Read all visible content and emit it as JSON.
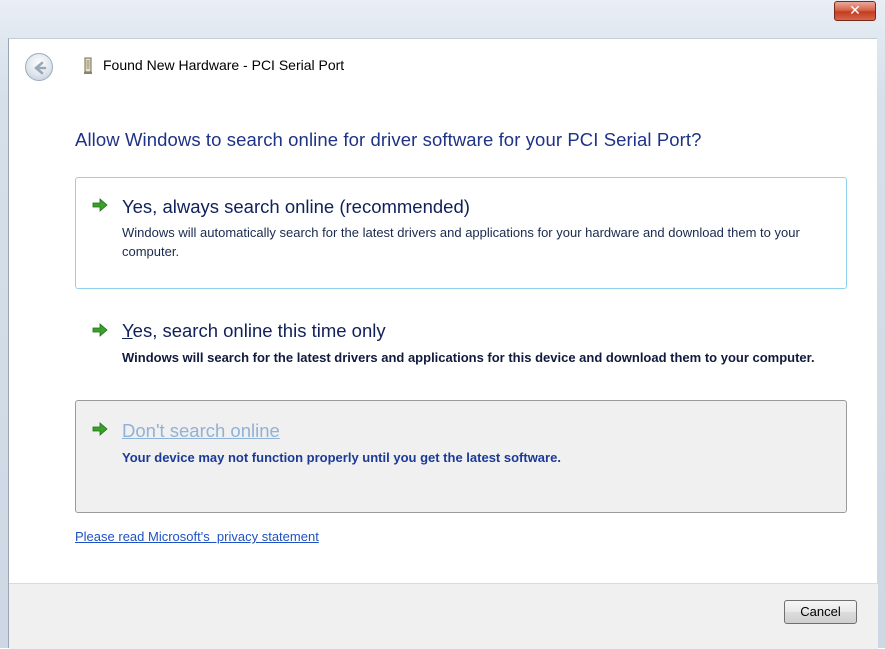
{
  "window": {
    "title": "Found New Hardware - PCI Serial Port",
    "close_glyph": "✕",
    "back_icon": "back-arrow-icon",
    "device_icon": "hardware-device-icon"
  },
  "question": "Allow Windows to search online for driver software for your PCI Serial Port?",
  "options": [
    {
      "title": "Yes, always search online (recommended)",
      "description": "Windows will automatically search for the latest drivers and applications for your hardware and download them to your computer.",
      "icon": "green-arrow-icon",
      "state": "hover"
    },
    {
      "title_prefix": "Y",
      "title_rest": "es, search online this time only",
      "description": "Windows will search for the latest drivers and applications for this device and download them to your computer.",
      "icon": "green-arrow-icon",
      "state": "normal"
    },
    {
      "title_prefix": "D",
      "title_rest": "on't search online",
      "description": "Your device may not function properly until you get the latest software.",
      "icon": "green-arrow-icon",
      "state": "focused"
    }
  ],
  "privacy_link": "Please read Microsoft's  privacy statement",
  "footer": {
    "cancel_label": "Cancel"
  },
  "colors": {
    "accent_heading": "#1e3287",
    "link": "#1e52c4",
    "arrow": "#3aa12b",
    "close": "#c43c1f"
  }
}
